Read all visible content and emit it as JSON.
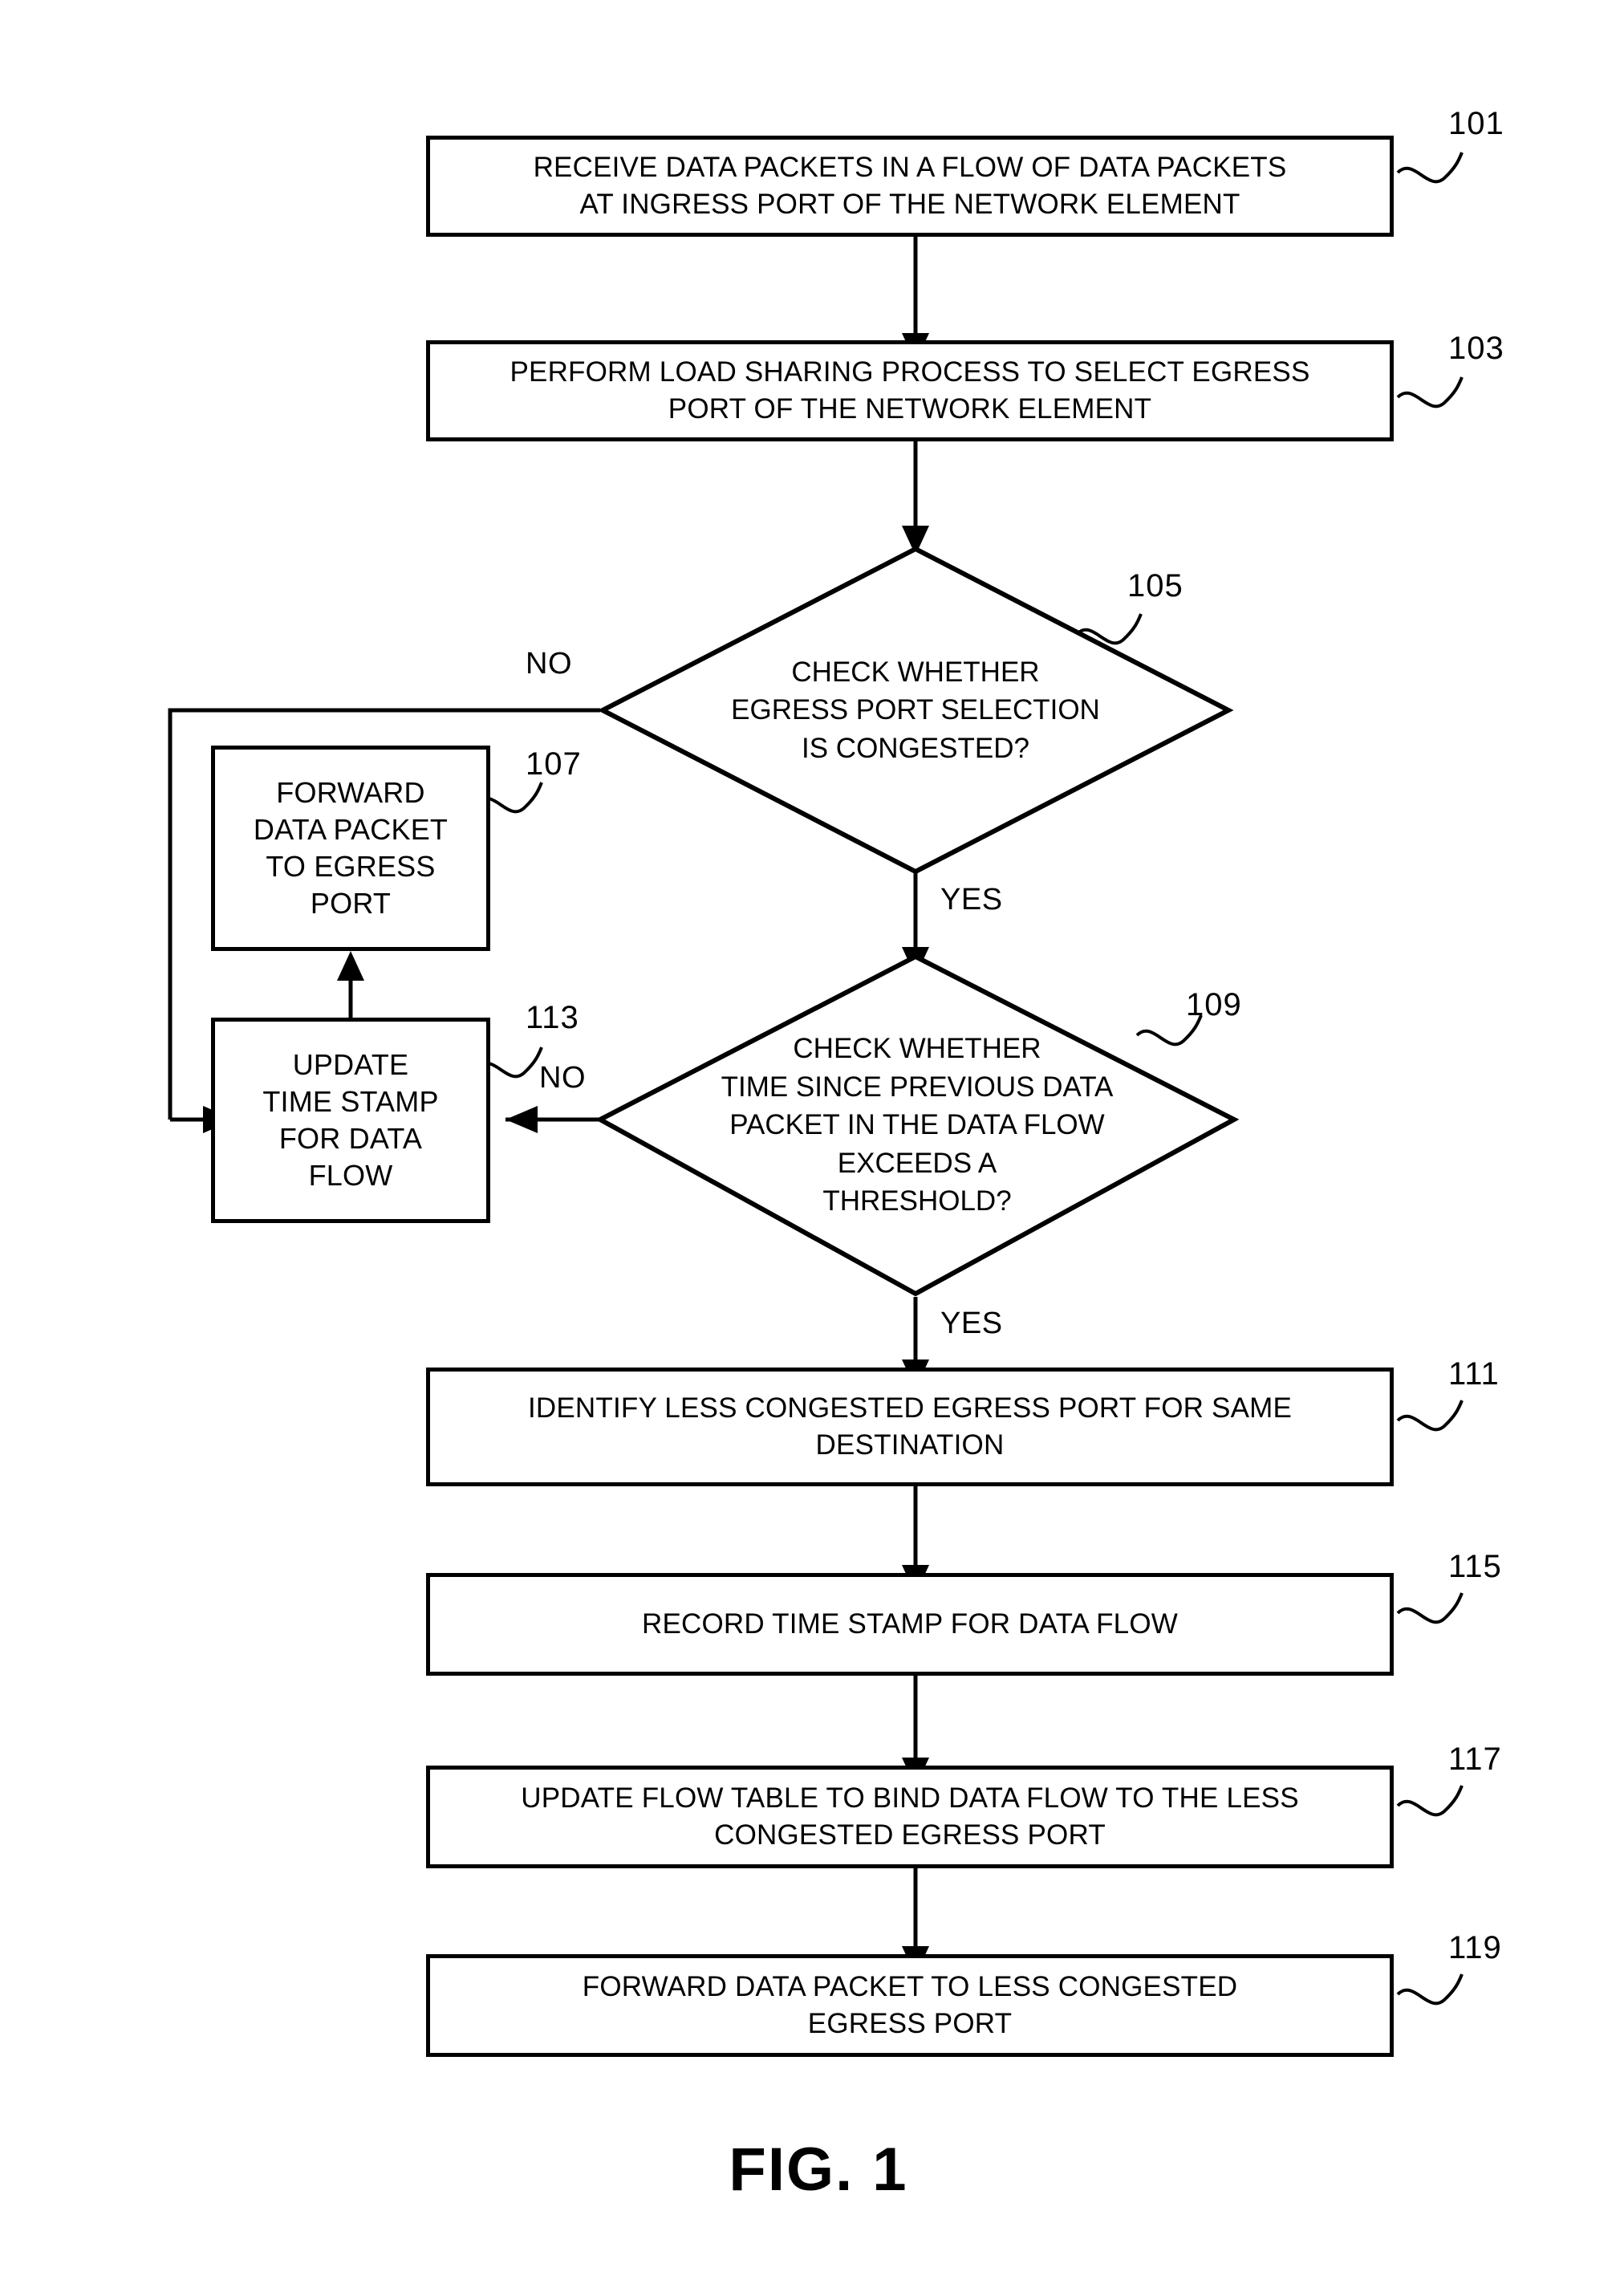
{
  "figure": {
    "caption": "FIG. 1",
    "title": "Flowchart of congestion-aware egress port selection"
  },
  "nodes": [
    {
      "id": "101",
      "shape": "process",
      "ref": "101",
      "text": "RECEIVE DATA PACKETS IN A FLOW OF DATA PACKETS\nAT INGRESS PORT OF THE NETWORK ELEMENT"
    },
    {
      "id": "103",
      "shape": "process",
      "ref": "103",
      "text": "PERFORM LOAD SHARING PROCESS TO SELECT EGRESS\nPORT OF THE NETWORK ELEMENT"
    },
    {
      "id": "105",
      "shape": "decision",
      "ref": "105",
      "text": "CHECK WHETHER\nEGRESS PORT SELECTION\nIS CONGESTED?"
    },
    {
      "id": "107",
      "shape": "process",
      "ref": "107",
      "text": "FORWARD\nDATA PACKET\nTO EGRESS\nPORT"
    },
    {
      "id": "109",
      "shape": "decision",
      "ref": "109",
      "text": "CHECK WHETHER\nTIME SINCE PREVIOUS DATA\nPACKET IN THE DATA FLOW\nEXCEEDS A\nTHRESHOLD?"
    },
    {
      "id": "111",
      "shape": "process",
      "ref": "111",
      "text": "IDENTIFY LESS CONGESTED EGRESS PORT FOR SAME\nDESTINATION"
    },
    {
      "id": "113",
      "shape": "process",
      "ref": "113",
      "text": "UPDATE\nTIME STAMP\nFOR DATA\nFLOW"
    },
    {
      "id": "115",
      "shape": "process",
      "ref": "115",
      "text": "RECORD TIME STAMP FOR DATA FLOW"
    },
    {
      "id": "117",
      "shape": "process",
      "ref": "117",
      "text": "UPDATE FLOW TABLE TO BIND DATA FLOW TO THE LESS\nCONGESTED EGRESS PORT"
    },
    {
      "id": "119",
      "shape": "process",
      "ref": "119",
      "text": "FORWARD DATA PACKET TO LESS CONGESTED\nEGRESS PORT"
    }
  ],
  "edge_labels": {
    "no_105": "NO",
    "yes_105": "YES",
    "no_109": "NO",
    "yes_109": "YES"
  },
  "colors": {
    "stroke": "#000000",
    "fill": "#ffffff",
    "text": "#000000"
  }
}
